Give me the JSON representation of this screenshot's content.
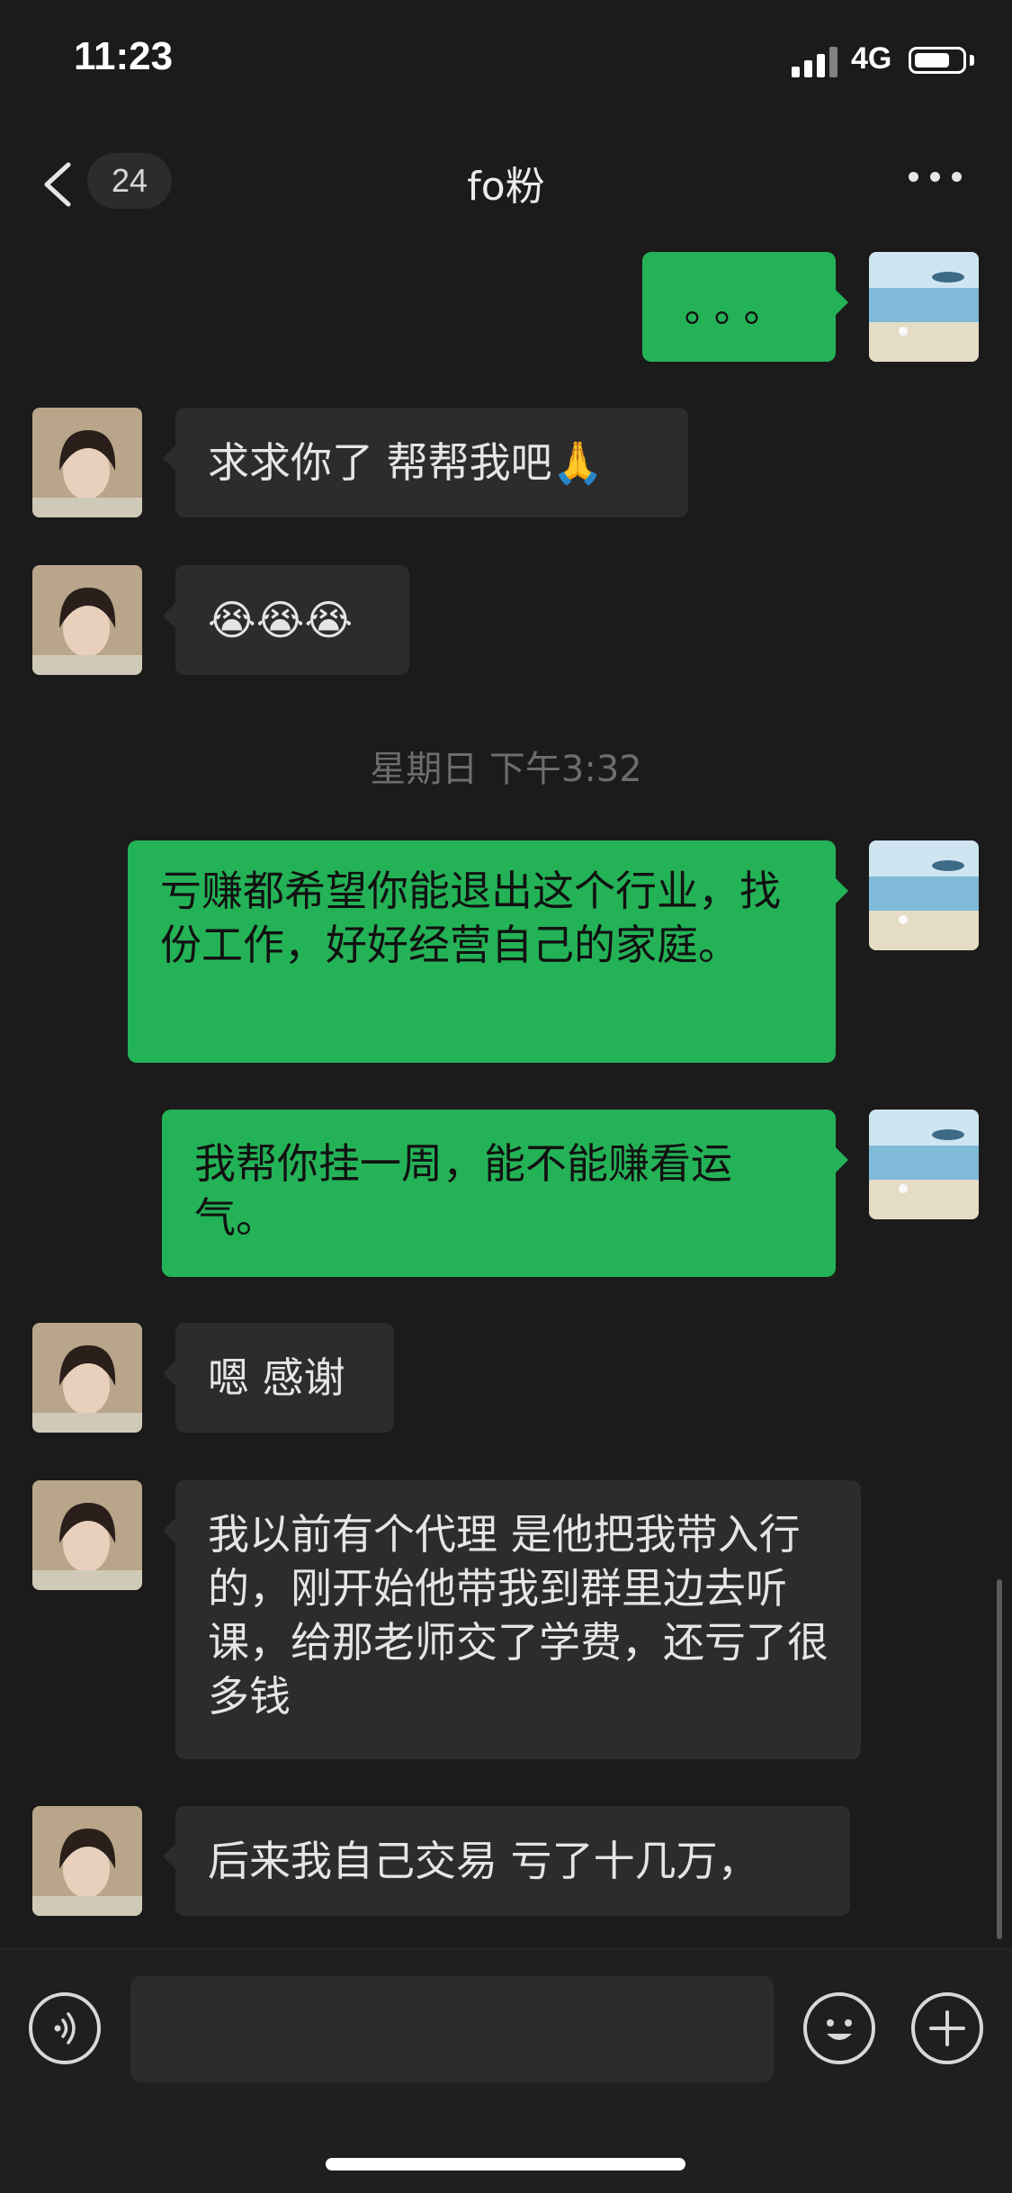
{
  "status_bar": {
    "time": "11:23",
    "network": "4G",
    "battery_level": 0.75
  },
  "nav": {
    "unread_count": "24",
    "title": "fo粉"
  },
  "messages": [
    {
      "side": "out",
      "text": "。。。"
    },
    {
      "side": "in",
      "text": "求求你了 帮帮我吧🙏"
    },
    {
      "side": "in",
      "text": "😭😭😭"
    },
    {
      "side": "out",
      "text": "亏赚都希望你能退出这个行业，找份工作，好好经营自己的家庭。"
    },
    {
      "side": "out",
      "text": "我帮你挂一周，能不能赚看运气。"
    },
    {
      "side": "in",
      "text": "嗯 感谢"
    },
    {
      "side": "in",
      "text": "我以前有个代理 是他把我带入行的，刚开始他带我到群里边去听课，给那老师交了学费，还亏了很多钱"
    },
    {
      "side": "in",
      "text": "后来我自己交易 亏了十几万，"
    }
  ],
  "timestamp": "星期日 下午3:32",
  "input": {
    "value": ""
  },
  "icons": {
    "back": "chevron-left-icon",
    "more": "more-dots-icon",
    "voice": "voice-icon",
    "emoji": "emoji-icon",
    "add": "plus-icon"
  },
  "colors": {
    "outgoing_bubble": "#24b257",
    "incoming_bubble": "#2c2c2c",
    "background": "#1b1b1b"
  }
}
